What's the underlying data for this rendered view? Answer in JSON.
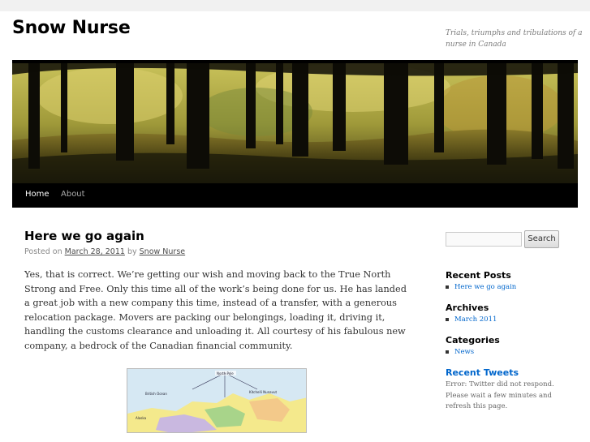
{
  "site": {
    "title": "Snow Nurse",
    "description": "Trials, triumphs and tribulations of a nurse in Canada"
  },
  "nav": {
    "items": [
      {
        "label": "Home"
      },
      {
        "label": "About"
      }
    ]
  },
  "post": {
    "title": "Here we go again",
    "posted_on": "Posted on",
    "date": "March 28, 2011",
    "by": "by",
    "author": "Snow Nurse",
    "body": "Yes, that is correct. We’re getting our wish and moving back to the True North Strong and Free. Only this time all of the work’s being done for us. He has landed a great job with a new company this time, instead of a transfer, with a generous relocation package. Movers are packing our belongings, loading it, driving it, handling the customs clearance and unloading it. All courtesy of his fabulous new company, a bedrock of the Canadian financial community."
  },
  "sidebar": {
    "search": {
      "button_label": "Search",
      "value": ""
    },
    "recent_posts": {
      "title": "Recent Posts",
      "items": [
        "Here we go again"
      ]
    },
    "archives": {
      "title": "Archives",
      "items": [
        "March 2011"
      ]
    },
    "categories": {
      "title": "Categories",
      "items": [
        "News"
      ]
    },
    "recent_tweets": {
      "title": "Recent Tweets",
      "error": "Error: Twitter did not respond. Please wait a few minutes and refresh this page."
    }
  },
  "map": {
    "labels": [
      "North Pole",
      "British Ocean",
      "Alaska",
      "Kitchelli Nunavut"
    ]
  },
  "colors": {
    "link": "#0066cc",
    "nav_bg": "#000000",
    "page_bg": "#f1f1f1"
  }
}
